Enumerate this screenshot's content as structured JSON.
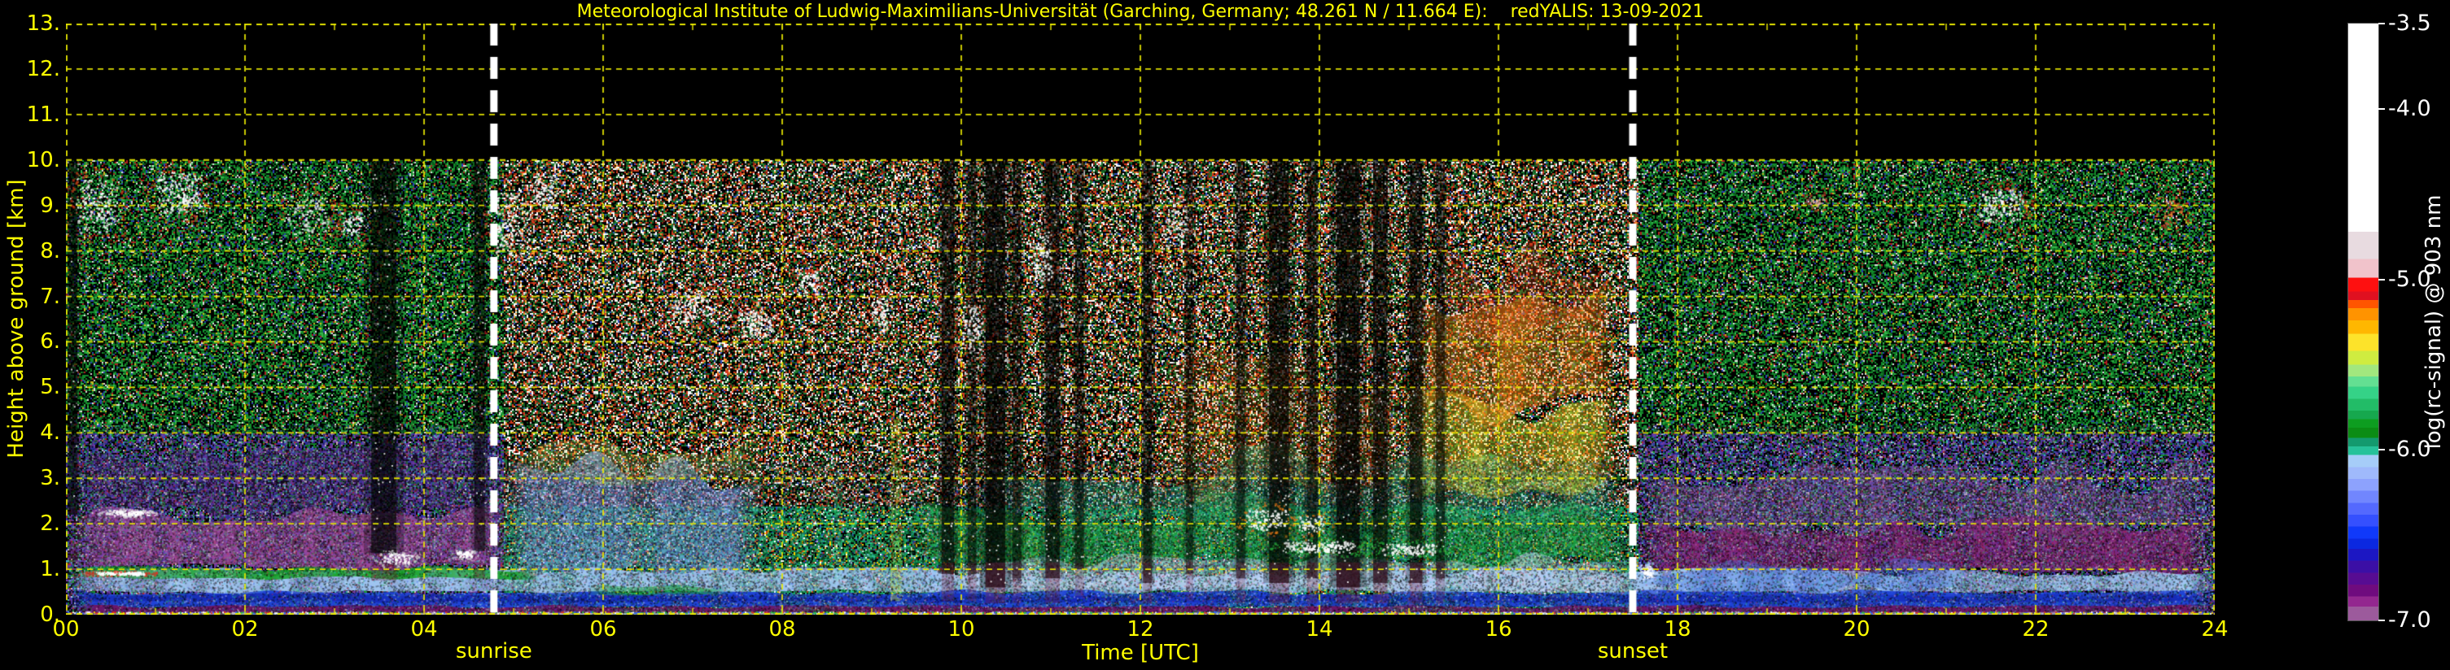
{
  "header": {
    "title": "Meteorological Institute of Ludwig-Maximilians-Universität (Garching, Germany; 48.261 N / 11.664 E):    redYALIS: 13-09-2021"
  },
  "colors": {
    "background": "#000000",
    "axis_text": "#ffff00",
    "colorbar_text": "#ffffff",
    "grid": "#e8e800",
    "annotation_line": "#ffffff"
  },
  "chart_data": {
    "type": "heatmap",
    "title": "Meteorological Institute of Ludwig-Maximilians-Universität (Garching, Germany; 48.261 N / 11.664 E):    redYALIS: 13-09-2021",
    "instrument": "redYALIS",
    "date": "13-09-2021",
    "xlabel": "Time [UTC]",
    "ylabel": "Height above ground [km]",
    "colorbar_label": "log(rc-signal) @ 903 nm",
    "xlim": [
      0,
      24
    ],
    "ylim": [
      0,
      13
    ],
    "grid": true,
    "data_height_range_km": [
      0,
      10
    ],
    "x_ticks": {
      "values": [
        0,
        2,
        4,
        6,
        8,
        10,
        12,
        14,
        16,
        18,
        20,
        22,
        24
      ],
      "labels": [
        "00",
        "02",
        "04",
        "06",
        "08",
        "10",
        "12",
        "14",
        "16",
        "18",
        "20",
        "22",
        "24"
      ]
    },
    "y_ticks": {
      "values": [
        0,
        1,
        2,
        3,
        4,
        5,
        6,
        7,
        8,
        9,
        10,
        11,
        12,
        13
      ],
      "labels": [
        "0.",
        "1.",
        "2.",
        "3.",
        "4.",
        "5.",
        "6.",
        "7.",
        "8.",
        "9.",
        "10.",
        "11.",
        "12.",
        "13."
      ]
    },
    "colorbar_range": [
      -3.5,
      -7.0
    ],
    "colorbar_ticks": {
      "values": [
        -3.5,
        -4.0,
        -5.0,
        -6.0,
        -7.0
      ],
      "labels": [
        "-3.5",
        "-4.0",
        "-5.0",
        "-6.0",
        "-7.0"
      ]
    },
    "colormap": [
      [
        -3.5,
        "#ffffff"
      ],
      [
        -4.72,
        "#e8dbe0"
      ],
      [
        -4.88,
        "#f1c3cb"
      ],
      [
        -4.99,
        "#fe1010"
      ],
      [
        -5.07,
        "#e01020"
      ],
      [
        -5.12,
        "#ff5500"
      ],
      [
        -5.17,
        "#ff9300"
      ],
      [
        -5.24,
        "#ffb700"
      ],
      [
        -5.32,
        "#fde32a"
      ],
      [
        -5.42,
        "#cfec40"
      ],
      [
        -5.5,
        "#a2e77e"
      ],
      [
        -5.57,
        "#63df92"
      ],
      [
        -5.63,
        "#35d287"
      ],
      [
        -5.7,
        "#22bc67"
      ],
      [
        -5.77,
        "#16a84e"
      ],
      [
        -5.82,
        "#0d9d20"
      ],
      [
        -5.87,
        "#0b8c14"
      ],
      [
        -5.93,
        "#139a6e"
      ],
      [
        -5.98,
        "#26c29a"
      ],
      [
        -6.03,
        "#a6cdf8"
      ],
      [
        -6.1,
        "#9fb9fb"
      ],
      [
        -6.17,
        "#8da2fd"
      ],
      [
        -6.24,
        "#7186fe"
      ],
      [
        -6.31,
        "#5469fe"
      ],
      [
        -6.38,
        "#3550fe"
      ],
      [
        -6.45,
        "#1039fa"
      ],
      [
        -6.52,
        "#0b28e0"
      ],
      [
        -6.58,
        "#1c17c3"
      ],
      [
        -6.65,
        "#3b0fa5"
      ],
      [
        -6.72,
        "#570c92"
      ],
      [
        -6.79,
        "#6f0b7e"
      ],
      [
        -6.86,
        "#93278f"
      ],
      [
        -6.92,
        "#9c5a9c"
      ],
      [
        -7.0,
        "#a991ad"
      ]
    ],
    "annotations": [
      {
        "label": "sunrise",
        "time_utc": 4.78
      },
      {
        "label": "sunset",
        "time_utc": 17.5
      }
    ],
    "features": {
      "base_noise": {
        "night_high": [
          [
            "#000000",
            40
          ],
          [
            "#128a2a",
            22
          ],
          [
            "#0a5a1c",
            14
          ],
          [
            "#35b54a",
            8
          ],
          [
            "#2a3fb0",
            5
          ],
          [
            "#b02020",
            4
          ],
          [
            "#c8b820",
            3
          ],
          [
            "#dddddd",
            4
          ]
        ],
        "night_mid": [
          [
            "#000000",
            30
          ],
          [
            "#2a2f9e",
            17
          ],
          [
            "#5a35a8",
            16
          ],
          [
            "#128a2a",
            12
          ],
          [
            "#7a3f9e",
            12
          ],
          [
            "#3fb5c0",
            5
          ],
          [
            "#cccccc",
            4
          ],
          [
            "#b02020",
            4
          ]
        ],
        "day_high": [
          [
            "#000000",
            36
          ],
          [
            "#ffffff",
            11
          ],
          [
            "#d33a1e",
            11
          ],
          [
            "#8a1e10",
            6
          ],
          [
            "#1c7a30",
            13
          ],
          [
            "#0f5520",
            10
          ],
          [
            "#f0a030",
            5
          ],
          [
            "#3050c0",
            3
          ],
          [
            "#c8c8c8",
            5
          ]
        ],
        "day_low": [
          [
            "#0d7a3a",
            28
          ],
          [
            "#16a05a",
            18
          ],
          [
            "#000000",
            20
          ],
          [
            "#2abf8a",
            14
          ],
          [
            "#ffd700",
            6
          ],
          [
            "#ffffff",
            5
          ],
          [
            "#d04010",
            5
          ],
          [
            "#3050c0",
            4
          ]
        ]
      },
      "bands": [
        {
          "t0": 0,
          "t1": 4.95,
          "h0": 2.2,
          "h1": 3.7,
          "c": "#5a2f86",
          "a": 0.38,
          "j": 0.5
        },
        {
          "t0": 0,
          "t1": 4.95,
          "h0": 1.02,
          "h1": 2.25,
          "c": "#a34b9c",
          "a": 0.7,
          "j": 0.25
        },
        {
          "t0": 17.55,
          "t1": 24,
          "h0": 1.85,
          "h1": 3.05,
          "c": "#8b5f9e",
          "a": 0.45,
          "j": 0.45
        },
        {
          "t0": 17.55,
          "t1": 24,
          "h0": 0.9,
          "h1": 1.9,
          "c": "#8c2577",
          "a": 0.75,
          "j": 0.3
        },
        {
          "t0": 4.9,
          "t1": 7.8,
          "h0": 0.9,
          "h1": 3.2,
          "c": "#7f9bf0",
          "a": 0.5,
          "j": 0.5
        },
        {
          "t0": 4.9,
          "t1": 7.8,
          "h0": 2.95,
          "h1": 3.6,
          "c": "#c8d860",
          "a": 0.25,
          "j": 0.35
        },
        {
          "t0": 9.4,
          "t1": 17.45,
          "h0": 1.15,
          "h1": 2.3,
          "c": "#1f9e3c",
          "a": 0.55,
          "j": 0.4
        },
        {
          "t0": 10.2,
          "t1": 17.4,
          "h0": 2.2,
          "h1": 3.3,
          "c": "#2bb489",
          "a": 0.35,
          "j": 0.5
        },
        {
          "t0": 12.2,
          "t1": 15.0,
          "h0": 2.8,
          "h1": 5.6,
          "c": "#ff9214",
          "a": 0.15,
          "j": 0.8
        },
        {
          "t0": 14.9,
          "t1": 17.35,
          "h0": 2.7,
          "h1": 4.7,
          "c": "#f4e52a",
          "a": 0.4,
          "j": 0.5
        },
        {
          "t0": 15.0,
          "t1": 17.3,
          "h0": 4.5,
          "h1": 6.9,
          "c": "#ff9214",
          "a": 0.4,
          "j": 0.9
        },
        {
          "t0": 15.3,
          "t1": 17.25,
          "h0": 6.4,
          "h1": 7.6,
          "c": "#e04818",
          "a": 0.25,
          "j": 0.8
        },
        {
          "t0": 0,
          "t1": 24,
          "h0": 0.5,
          "h1": 0.95,
          "c": "#9fc4f0",
          "a": 0.85,
          "j": 0.12
        },
        {
          "t0": 9.8,
          "t1": 17.5,
          "h0": 0.55,
          "h1": 1.2,
          "c": "#ccd7f4",
          "a": 0.5,
          "j": 0.2
        },
        {
          "t0": 17.55,
          "t1": 21.2,
          "h0": 0.55,
          "h1": 1.05,
          "c": "#4a78e8",
          "a": 0.5,
          "j": 0.3
        },
        {
          "t0": 0,
          "t1": 24,
          "h0": 0.16,
          "h1": 0.5,
          "c": "#1f43d6",
          "a": 0.9,
          "j": 0.06
        },
        {
          "t0": 0,
          "t1": 24,
          "h0": 0.28,
          "h1": 0.42,
          "c": "#101ca8",
          "a": 0.5,
          "j": 0.05
        },
        {
          "t0": 0,
          "t1": 24,
          "h0": 0.05,
          "h1": 0.18,
          "c": "#6a1668",
          "a": 0.9,
          "j": 0.04
        },
        {
          "t0": 5.8,
          "t1": 7.4,
          "h0": 0.45,
          "h1": 0.62,
          "c": "#1da03a",
          "a": 0.55,
          "j": 0.07
        },
        {
          "t0": 0,
          "t1": 5.3,
          "h0": 0.8,
          "h1": 1.0,
          "c": "#17a326",
          "a": 0.75,
          "j": 0.09
        },
        {
          "t0": 0,
          "t1": 24,
          "h0": 0.0,
          "h1": 0.045,
          "c": "#b9b2c2",
          "a": 0.95,
          "j": 0.01
        }
      ],
      "dark_columns": [
        {
          "t": 0.08,
          "w": 0.1,
          "h0": 2.2,
          "a": 0.55
        },
        {
          "t": 3.55,
          "w": 0.28,
          "h0": 1.35,
          "a": 0.6
        },
        {
          "t": 4.62,
          "w": 0.12,
          "h0": 1.4,
          "a": 0.5
        },
        {
          "t": 9.85,
          "w": 0.14,
          "h0": 0.9,
          "a": 0.6
        },
        {
          "t": 10.12,
          "w": 0.1,
          "h0": 0.9,
          "a": 0.5
        },
        {
          "t": 10.38,
          "w": 0.22,
          "h0": 0.6,
          "a": 0.7
        },
        {
          "t": 10.62,
          "w": 0.1,
          "h0": 0.8,
          "a": 0.5
        },
        {
          "t": 11.02,
          "w": 0.16,
          "h0": 0.8,
          "a": 0.6
        },
        {
          "t": 11.32,
          "w": 0.1,
          "h0": 1.0,
          "a": 0.5
        },
        {
          "t": 12.08,
          "w": 0.1,
          "h0": 0.7,
          "a": 0.55
        },
        {
          "t": 12.55,
          "w": 0.08,
          "h0": 0.9,
          "a": 0.45
        },
        {
          "t": 13.12,
          "w": 0.1,
          "h0": 0.8,
          "a": 0.5
        },
        {
          "t": 13.55,
          "w": 0.22,
          "h0": 0.7,
          "a": 0.65
        },
        {
          "t": 13.92,
          "w": 0.12,
          "h0": 0.8,
          "a": 0.55
        },
        {
          "t": 14.32,
          "w": 0.26,
          "h0": 0.6,
          "a": 0.7
        },
        {
          "t": 14.68,
          "w": 0.16,
          "h0": 0.7,
          "a": 0.6
        },
        {
          "t": 15.08,
          "w": 0.14,
          "h0": 0.7,
          "a": 0.6
        },
        {
          "t": 15.35,
          "w": 0.1,
          "h0": 0.8,
          "a": 0.5
        }
      ],
      "bright_columns": [
        {
          "t": 9.27,
          "w": 0.12,
          "h0": 0.3,
          "h1": 4.3,
          "c": "#cade32",
          "a": 0.4
        },
        {
          "t": 8.62,
          "w": 0.08,
          "h0": 0.5,
          "h1": 3.2,
          "c": "#58c8a0",
          "a": 0.3
        }
      ],
      "blobs": [
        {
          "t": 0.35,
          "h": 9.0,
          "dt": 0.5,
          "dh": 1.3,
          "n": 260,
          "core": "#ffffff",
          "fringe": "#e03818"
        },
        {
          "t": 1.25,
          "h": 9.3,
          "dt": 0.55,
          "dh": 1.0,
          "n": 300,
          "core": "#ffffff",
          "fringe": "#e03818"
        },
        {
          "t": 2.7,
          "h": 8.8,
          "dt": 0.5,
          "dh": 0.9,
          "n": 150,
          "core": "#e8e8e8",
          "fringe": "#d04020"
        },
        {
          "t": 3.2,
          "h": 8.6,
          "dt": 0.3,
          "dh": 0.6,
          "n": 90,
          "core": "#ffffff",
          "fringe": "#cc3018"
        },
        {
          "t": 4.95,
          "h": 8.6,
          "dt": 0.5,
          "dh": 1.6,
          "n": 260,
          "core": "#ffffff",
          "fringe": "#e04020"
        },
        {
          "t": 5.35,
          "h": 9.3,
          "dt": 0.3,
          "dh": 0.8,
          "n": 120,
          "core": "#ffffff",
          "fringe": "#e04020"
        },
        {
          "t": 7.0,
          "h": 6.8,
          "dt": 0.55,
          "dh": 0.8,
          "n": 210,
          "core": "#ffffff",
          "fringe": "#d83820"
        },
        {
          "t": 7.7,
          "h": 6.4,
          "dt": 0.45,
          "dh": 0.7,
          "n": 170,
          "core": "#ffffff",
          "fringe": "#d83820"
        },
        {
          "t": 8.3,
          "h": 7.3,
          "dt": 0.3,
          "dh": 0.6,
          "n": 90,
          "core": "#ffffff",
          "fringe": "#d83820"
        },
        {
          "t": 9.1,
          "h": 6.6,
          "dt": 0.25,
          "dh": 0.9,
          "n": 110,
          "core": "#ffffff",
          "fringe": "#cc3018"
        },
        {
          "t": 10.1,
          "h": 6.3,
          "dt": 0.3,
          "dh": 1.2,
          "n": 150,
          "core": "#ffffff",
          "fringe": "#cc3018"
        },
        {
          "t": 10.9,
          "h": 7.8,
          "dt": 0.25,
          "dh": 1.6,
          "n": 150,
          "core": "#ffffff",
          "fringe": "#c03018"
        },
        {
          "t": 12.4,
          "h": 8.5,
          "dt": 0.3,
          "dh": 1.0,
          "n": 110,
          "core": "#e8e8e8",
          "fringe": "#c03018"
        },
        {
          "t": 13.4,
          "h": 2.1,
          "dt": 0.5,
          "dh": 0.5,
          "n": 160,
          "core": "#ffffff",
          "fringe": "#e87818"
        },
        {
          "t": 13.9,
          "h": 2.0,
          "dt": 0.3,
          "dh": 0.4,
          "n": 90,
          "core": "#ffffff",
          "fringe": "#e87818"
        },
        {
          "t": 14.0,
          "h": 1.5,
          "dt": 0.9,
          "dh": 0.28,
          "n": 220,
          "core": "#ffffff",
          "fringe": "#28a838"
        },
        {
          "t": 15.0,
          "h": 1.45,
          "dt": 0.7,
          "dh": 0.28,
          "n": 180,
          "core": "#ffffff",
          "fringe": "#28a838"
        },
        {
          "t": 0.7,
          "h": 2.25,
          "dt": 0.5,
          "dh": 0.13,
          "n": 170,
          "core": "#ffffff",
          "fringe": "#dddddd"
        },
        {
          "t": 0.6,
          "h": 0.92,
          "dt": 0.6,
          "dh": 0.08,
          "n": 200,
          "core": "#ffffff",
          "fringe": "#e03020"
        },
        {
          "t": 3.7,
          "h": 1.25,
          "dt": 0.35,
          "dh": 0.25,
          "n": 120,
          "core": "#ffffff",
          "fringe": "#cccccc"
        },
        {
          "t": 4.45,
          "h": 1.35,
          "dt": 0.2,
          "dh": 0.2,
          "n": 70,
          "core": "#ffffff",
          "fringe": "#cccccc"
        },
        {
          "t": 17.65,
          "h": 0.95,
          "dt": 0.15,
          "dh": 0.35,
          "n": 90,
          "core": "#ffffff",
          "fringe": "#aaccff"
        },
        {
          "t": 21.6,
          "h": 9.0,
          "dt": 0.55,
          "dh": 0.8,
          "n": 240,
          "core": "#ffffff",
          "fringe": "#d83518"
        },
        {
          "t": 19.55,
          "h": 9.1,
          "dt": 0.2,
          "dh": 0.3,
          "n": 50,
          "core": "#e0b0a0",
          "fringe": "#c04028"
        },
        {
          "t": 23.5,
          "h": 8.9,
          "dt": 0.4,
          "dh": 0.7,
          "n": 90,
          "core": "#e06030",
          "fringe": "#a03018"
        }
      ],
      "bottom_sparkle_colors": [
        "#e03020",
        "#20c040",
        "#ffffff",
        "#ffd000",
        "#3060ff",
        "#cccccc"
      ]
    }
  }
}
